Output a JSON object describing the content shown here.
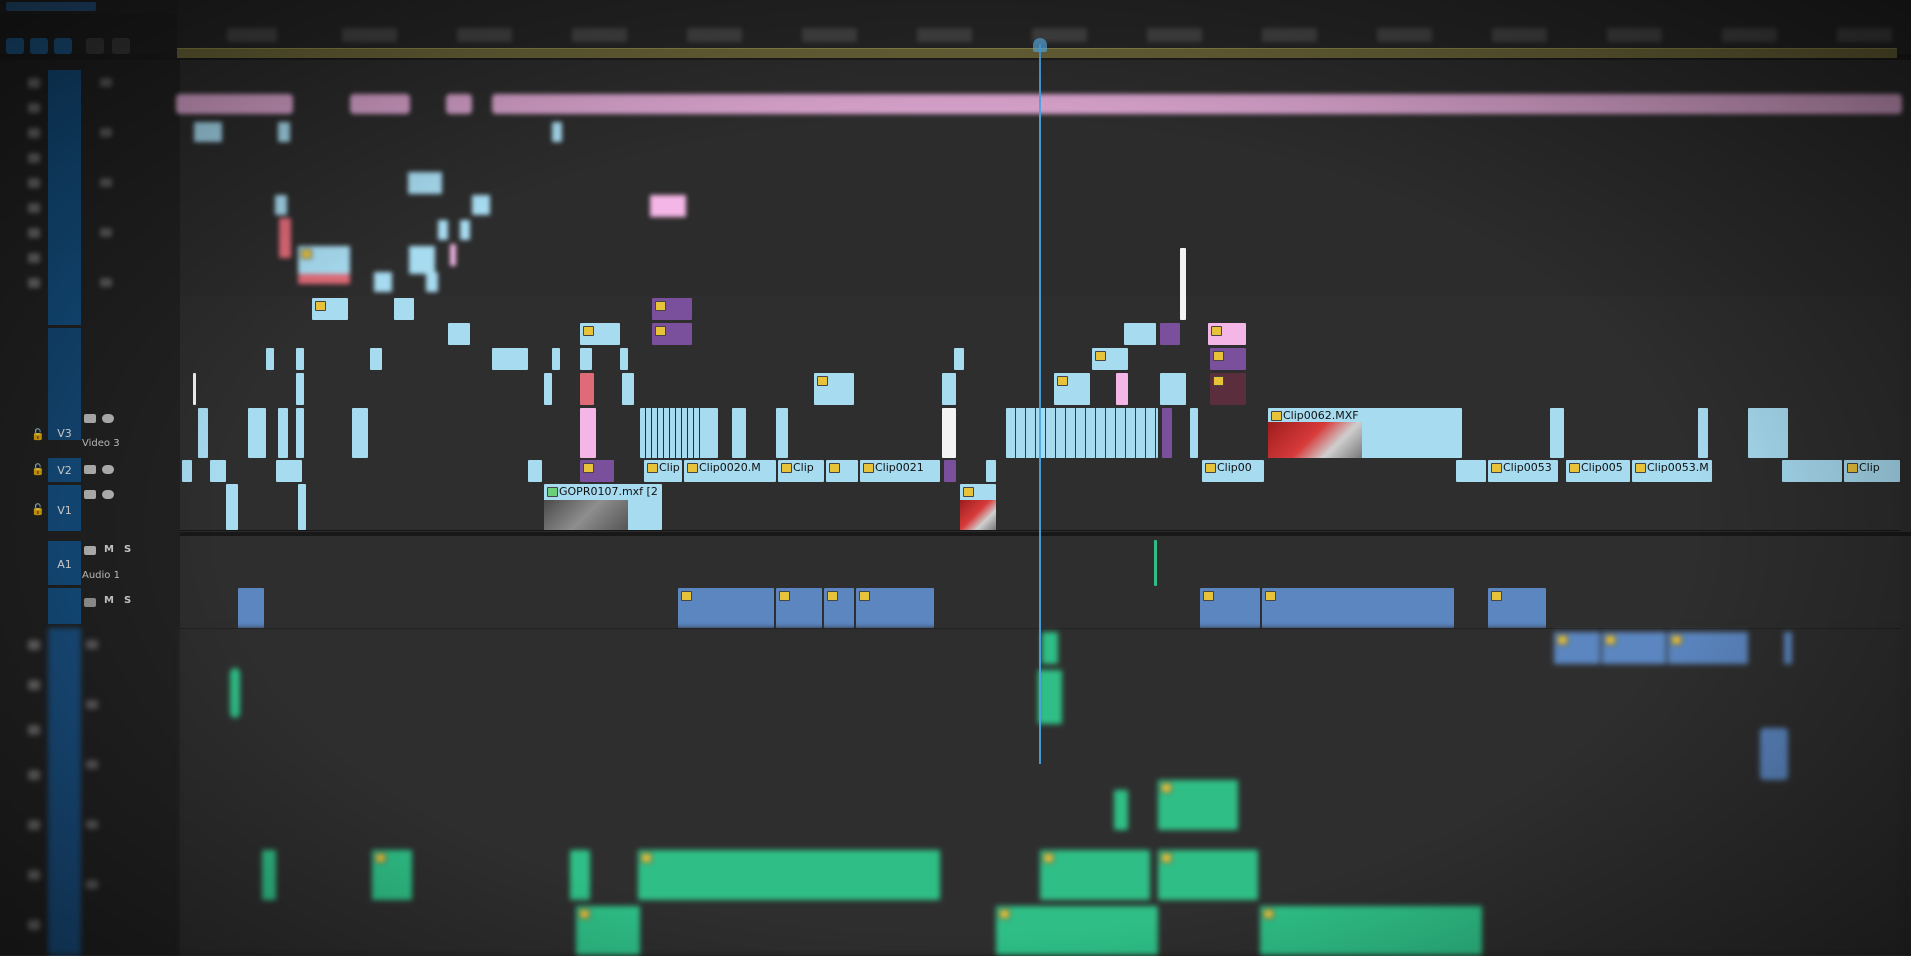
{
  "tracks": {
    "v3": {
      "id": "V3",
      "name": "Video 3"
    },
    "v2": {
      "id": "V2"
    },
    "v1": {
      "id": "V1"
    },
    "a1": {
      "id": "A1",
      "name": "Audio 1",
      "mute": "M",
      "solo": "S"
    },
    "a2": {
      "mute": "M",
      "solo": "S"
    }
  },
  "clips": {
    "v3_main": "Clip0062.MXF",
    "v2_a": "Clip",
    "v2_b": "Clip0020.M",
    "v2_c": "Clip",
    "v2_d": "Clip0021",
    "v2_e": "Clip00",
    "v2_f": "Clip0053",
    "v2_g": "Clip005",
    "v2_h": "Clip0053.M",
    "v2_i": "Clip",
    "v1_main": "GOPR0107.mxf [2"
  },
  "colors": {
    "video_clip": "#a7dbf0",
    "adjust_clip": "#7a4f9c",
    "title_clip": "#f4b6e6",
    "audio_clip_blue": "#5b86c0",
    "audio_clip_green": "#2fbf86",
    "playhead": "#4aa5e6",
    "track_target": "#144f80",
    "work_area": "#6a6438"
  },
  "icons": [
    "film-icon",
    "eye-icon",
    "lock-icon",
    "fx-badge-icon",
    "wrench-icon",
    "snap-icon",
    "marker-icon"
  ]
}
